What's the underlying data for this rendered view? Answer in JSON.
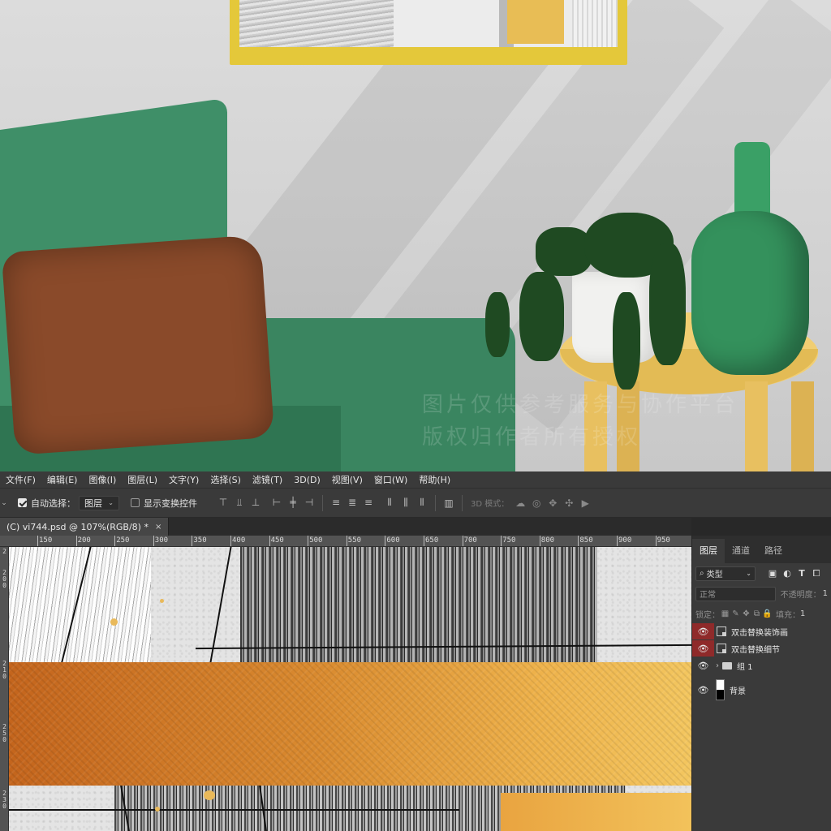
{
  "menu": [
    "文件(F)",
    "编辑(E)",
    "图像(I)",
    "图层(L)",
    "文字(Y)",
    "选择(S)",
    "滤镜(T)",
    "3D(D)",
    "视图(V)",
    "窗口(W)",
    "帮助(H)"
  ],
  "options": {
    "auto_select_label": "自动选择：",
    "auto_select_checked": true,
    "auto_select_value": "图层",
    "show_transform_label": "显示变换控件",
    "show_transform_checked": false,
    "mode_3d_label": "3D 模式："
  },
  "document_tab": {
    "title": "(C) vi744.psd @ 107%(RGB/8) *",
    "close": "×"
  },
  "ruler": {
    "h_labels": [
      "150",
      "200",
      "250",
      "300",
      "350",
      "400",
      "450",
      "500",
      "550",
      "600",
      "650",
      "700",
      "750",
      "800",
      "850",
      "900",
      "950"
    ],
    "v_labels": [
      "2",
      "2\n0\n0",
      "2\n1\n0",
      "2\n5\n0",
      "2\n3\n0"
    ]
  },
  "layers_panel": {
    "tabs": [
      "图层",
      "通道",
      "路径"
    ],
    "active_tab": "图层",
    "filter_label": "类型",
    "blend_mode": "正常",
    "opacity_label": "不透明度：",
    "opacity_value": "1",
    "lock_label": "锁定：",
    "fill_label": "填充：",
    "fill_value": "1",
    "layers": [
      {
        "name": "双击替换装饰画",
        "type": "smart",
        "visible": true,
        "highlighted": true
      },
      {
        "name": "双击替换细节",
        "type": "smart",
        "visible": true,
        "highlighted": true
      },
      {
        "name": "组 1",
        "type": "group",
        "visible": true,
        "highlighted": false
      },
      {
        "name": "背景",
        "type": "background",
        "visible": true,
        "highlighted": false
      }
    ]
  },
  "watermark": [
    "图片仅供参考服务与协作平台",
    "版权归作者所有授权"
  ],
  "colors": {
    "ui_bg": "#3a3a3a",
    "highlight_eye": "#8f2a2a",
    "gradient_start": "#c4651d",
    "gradient_end": "#f3c65f",
    "chair_green": "#3f8f68",
    "table_yellow": "#f1ce72"
  }
}
